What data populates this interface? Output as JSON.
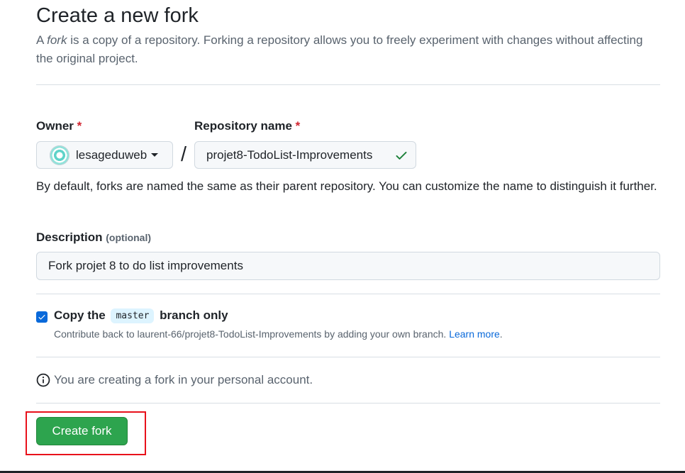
{
  "header": {
    "title": "Create a new fork",
    "intro_before": "A ",
    "intro_emph": "fork",
    "intro_after": " is a copy of a repository. Forking a repository allows you to freely experiment with changes without affecting the original project."
  },
  "owner": {
    "label": "Owner",
    "required_mark": "*",
    "selected": "lesageduweb"
  },
  "separator": "/",
  "repository": {
    "label": "Repository name",
    "required_mark": "*",
    "value": "projet8-TodoList-Improvements",
    "help": "By default, forks are named the same as their parent repository. You can customize the name to distinguish it further."
  },
  "description": {
    "label": "Description",
    "optional_note": "(optional)",
    "value": "Fork projet 8 to do list improvements"
  },
  "copy_branch": {
    "checked": true,
    "label_before": "Copy the",
    "branch": "master",
    "label_after": "branch only",
    "contrib_text": "Contribute back to laurent-66/projet8-TodoList-Improvements by adding your own branch.",
    "learn_more": "Learn more",
    "period": "."
  },
  "info": {
    "text": "You are creating a fork in your personal account."
  },
  "actions": {
    "create_label": "Create fork"
  },
  "colors": {
    "primary_button": "#2da44e",
    "link": "#0969da",
    "required": "#d1242f",
    "success_check": "#1a7f37",
    "highlight_border": "#e8111b"
  }
}
